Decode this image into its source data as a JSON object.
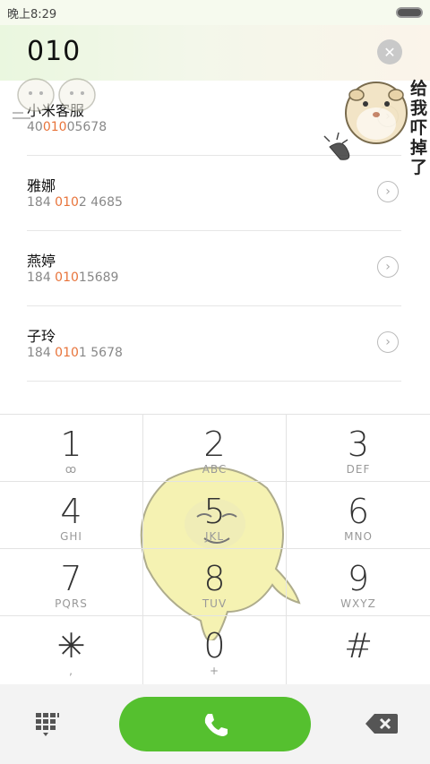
{
  "status_bar": {
    "time": "晚上8:29"
  },
  "dialer": {
    "input_value": "010"
  },
  "results": [
    {
      "name": "小米客服",
      "number_prefix": "40",
      "number_match": "010",
      "number_suffix": "05678"
    },
    {
      "name": "雅娜",
      "number_prefix": "184 ",
      "number_match": "010",
      "number_suffix": "2 4685"
    },
    {
      "name": "燕婷",
      "number_prefix": "184 ",
      "number_match": "010",
      "number_suffix": "15689"
    },
    {
      "name": "子玲",
      "number_prefix": "184 ",
      "number_match": "010",
      "number_suffix": "1 5678"
    }
  ],
  "sticker": {
    "text": "给我吓掉了"
  },
  "keypad": [
    {
      "digit": "1",
      "letters": "ꝏ"
    },
    {
      "digit": "2",
      "letters": "ABC"
    },
    {
      "digit": "3",
      "letters": "DEF"
    },
    {
      "digit": "4",
      "letters": "GHI"
    },
    {
      "digit": "5",
      "letters": "JKL"
    },
    {
      "digit": "6",
      "letters": "MNO"
    },
    {
      "digit": "7",
      "letters": "PQRS"
    },
    {
      "digit": "8",
      "letters": "TUV"
    },
    {
      "digit": "9",
      "letters": "WXYZ"
    },
    {
      "digit": "✳",
      "letters": ","
    },
    {
      "digit": "0",
      "letters": "+"
    },
    {
      "digit": "#",
      "letters": ""
    }
  ],
  "colors": {
    "call_green": "#55c02f",
    "match_orange": "#e8743b",
    "clear_gray": "#c9c9c9"
  },
  "icons": {
    "clear": "close-icon",
    "info": "chevron-right-icon",
    "keypad_toggle": "dialpad-icon",
    "call": "phone-icon",
    "backspace": "backspace-icon",
    "voicemail": "voicemail-icon"
  }
}
